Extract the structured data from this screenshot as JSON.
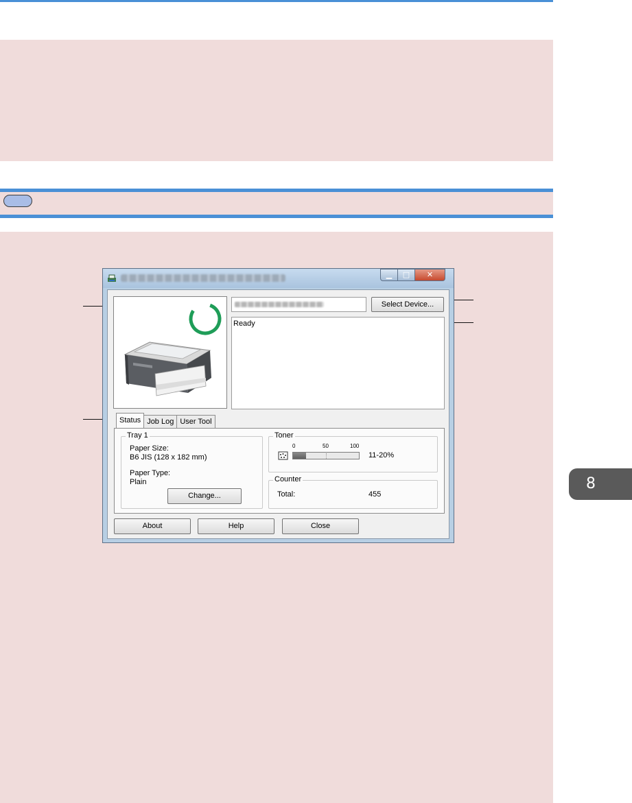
{
  "page": {
    "chapter_number": "8"
  },
  "window": {
    "buttons": {
      "minimize": "▁",
      "maximize": "□",
      "close": "✕"
    },
    "select_device_label": "Select Device...",
    "status_message": "Ready",
    "tabs": [
      {
        "label": "Status"
      },
      {
        "label": "Job Log"
      },
      {
        "label": "User Tool"
      }
    ],
    "tray": {
      "title": "Tray 1",
      "paper_size_label": "Paper Size:",
      "paper_size_value": "B6 JIS (128 x 182 mm)",
      "paper_type_label": "Paper Type:",
      "paper_type_value": "Plain",
      "change_button": "Change..."
    },
    "toner": {
      "title": "Toner",
      "scale": [
        "0",
        "50",
        "100"
      ],
      "level_text": "11-20%",
      "level_fraction": 0.2
    },
    "counter": {
      "title": "Counter",
      "total_label": "Total:",
      "total_value": "455"
    },
    "bottom_buttons": {
      "about": "About",
      "help": "Help",
      "close": "Close"
    }
  },
  "colors": {
    "accent_blue": "#4a90d6",
    "panel_pink": "#f0dcdb",
    "status_ring_green": "#1f9d58"
  }
}
